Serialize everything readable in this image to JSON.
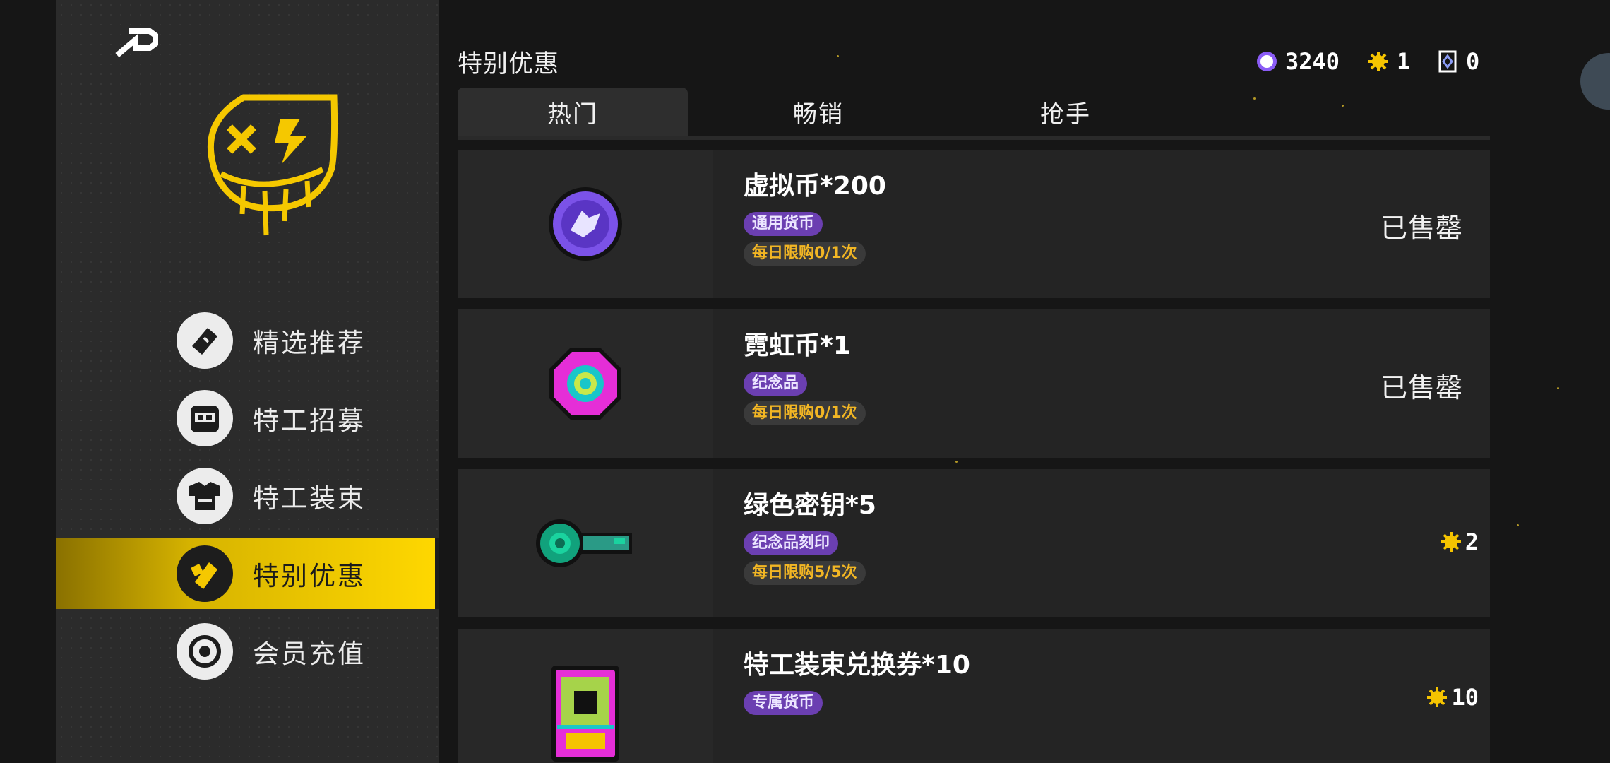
{
  "page": {
    "title": "特别优惠"
  },
  "currencies": [
    {
      "icon": "virtual-coin-icon",
      "value": "3240",
      "color": "#8b5cf6"
    },
    {
      "icon": "gold-gear-icon",
      "value": "1",
      "color": "#f5c400"
    },
    {
      "icon": "ticket-icon",
      "value": "0",
      "color": "#ffffff"
    }
  ],
  "sidebar": {
    "items": [
      {
        "label": "精选推荐",
        "icon": "ticket-icon",
        "active": false
      },
      {
        "label": "特工招募",
        "icon": "agent-face-icon",
        "active": false
      },
      {
        "label": "特工装束",
        "icon": "outfit-icon",
        "active": false
      },
      {
        "label": "特别优惠",
        "icon": "discount-tag-icon",
        "active": true
      },
      {
        "label": "会员充值",
        "icon": "coin-icon",
        "active": false
      }
    ]
  },
  "tabs": [
    {
      "label": "热门",
      "active": true
    },
    {
      "label": "畅销",
      "active": false
    },
    {
      "label": "抢手",
      "active": false
    }
  ],
  "items": [
    {
      "name": "虚拟币*200",
      "tag": "通用货币",
      "limit": "每日限购0/1次",
      "status": "已售罄",
      "price": "",
      "icon": "virtual-coin-icon"
    },
    {
      "name": "霓虹币*1",
      "tag": "纪念品",
      "limit": "每日限购0/1次",
      "status": "已售罄",
      "price": "",
      "icon": "neon-coin-icon"
    },
    {
      "name": "绿色密钥*5",
      "tag": "纪念品刻印",
      "limit": "每日限购5/5次",
      "status": "",
      "price": "2",
      "icon": "green-key-icon"
    },
    {
      "name": "特工装束兑换券*10",
      "tag": "专属货币",
      "limit": "",
      "status": "",
      "price": "10",
      "icon": "outfit-voucher-icon"
    }
  ],
  "colors": {
    "accent": "#ffd800",
    "tag_purple": "#6b3fb1",
    "limit_text": "#f2b624"
  }
}
